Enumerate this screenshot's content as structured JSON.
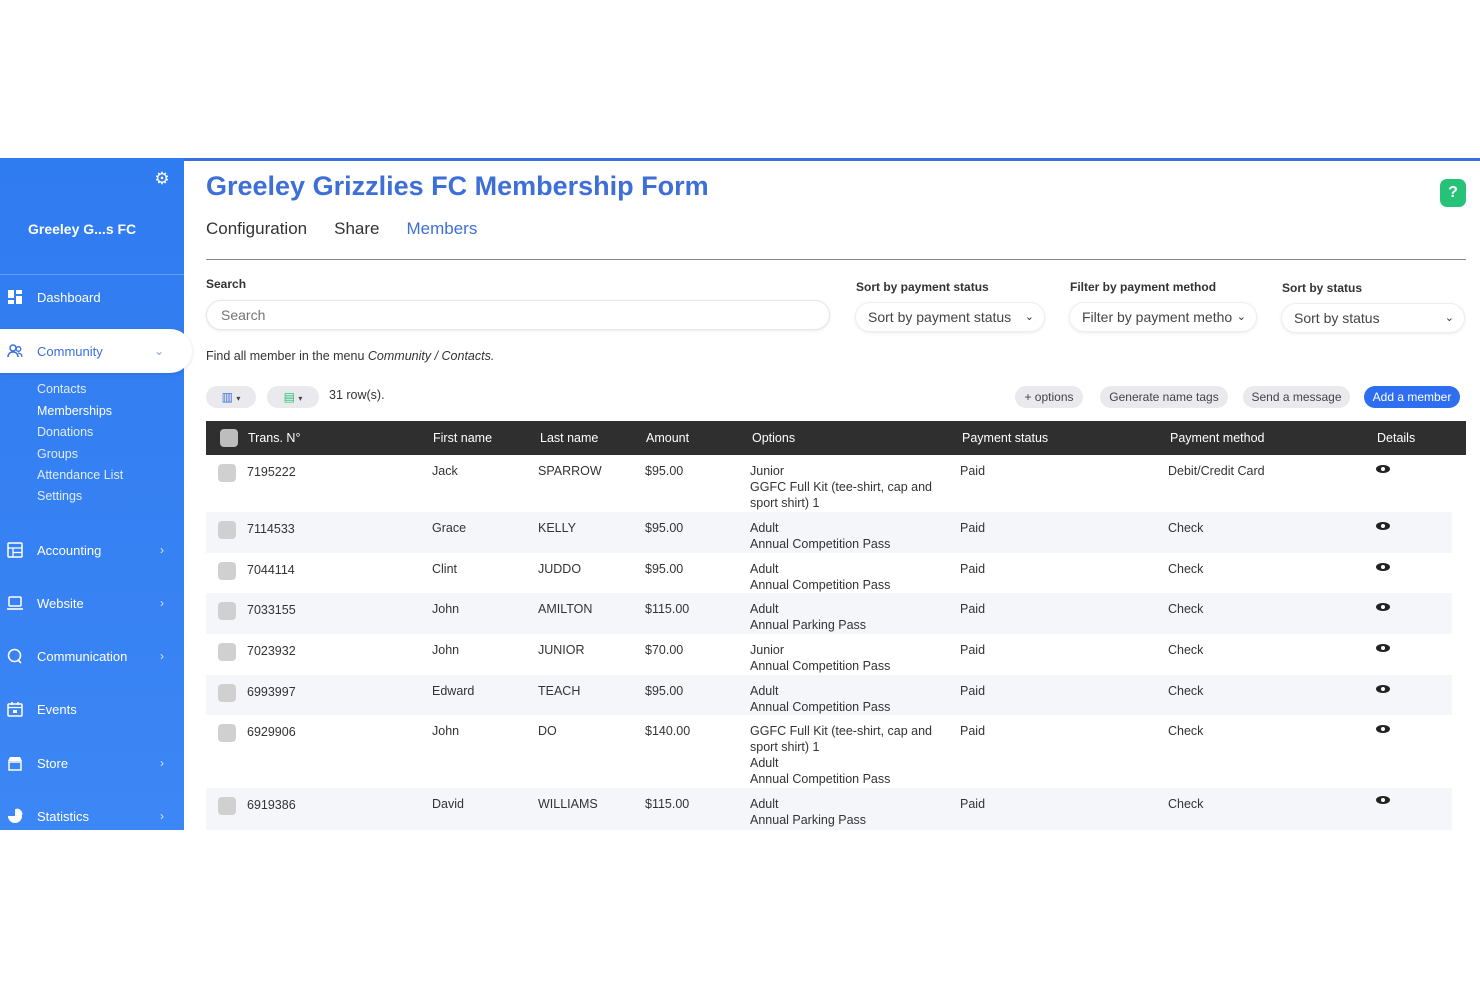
{
  "sidebar": {
    "org_name": "Greeley G...s FC",
    "nav": [
      {
        "label": "Dashboard",
        "icon": "dashboard-icon"
      },
      {
        "label": "Community",
        "icon": "community-icon"
      },
      {
        "label": "Accounting",
        "icon": "accounting-icon"
      },
      {
        "label": "Website",
        "icon": "website-icon"
      },
      {
        "label": "Communication",
        "icon": "communication-icon"
      },
      {
        "label": "Events",
        "icon": "events-icon"
      },
      {
        "label": "Store",
        "icon": "store-icon"
      },
      {
        "label": "Statistics",
        "icon": "statistics-icon"
      }
    ],
    "community_sub": [
      "Contacts",
      "Memberships",
      "Donations",
      "Groups",
      "Attendance List",
      "Settings"
    ]
  },
  "header": {
    "title": "Greeley Grizzlies FC Membership Form",
    "tabs": [
      "Configuration",
      "Share",
      "Members"
    ],
    "active_tab": "Members"
  },
  "filters": {
    "search_label": "Search",
    "search_placeholder": "Search",
    "sort_payment_label": "Sort by payment status",
    "sort_payment_value": "Sort by payment status",
    "filter_method_label": "Filter by payment method",
    "filter_method_value": "Filter by payment metho",
    "sort_status_label": "Sort by status",
    "sort_status_value": "Sort by status"
  },
  "hint": {
    "prefix": "Find all member in the menu ",
    "path": "Community / Contacts."
  },
  "toolbar": {
    "rows_count": "31 row(s).",
    "options": "+ options",
    "name_tags": "Generate name tags",
    "send_message": "Send a message",
    "add_member": "Add a member"
  },
  "table": {
    "headers": [
      "Trans. N°",
      "First name",
      "Last name",
      "Amount",
      "Options",
      "Payment status",
      "Payment method",
      "Details"
    ],
    "rows": [
      {
        "trans": "7195222",
        "first": "Jack",
        "last": "SPARROW",
        "amount": "$95.00",
        "options": [
          "Junior",
          "GGFC Full Kit (tee-shirt, cap and",
          "sport shirt) 1"
        ],
        "status": "Paid",
        "method": "Debit/Credit Card"
      },
      {
        "trans": "7114533",
        "first": "Grace",
        "last": "KELLY",
        "amount": "$95.00",
        "options": [
          "Adult",
          "Annual Competition Pass"
        ],
        "status": "Paid",
        "method": "Check"
      },
      {
        "trans": "7044114",
        "first": "Clint",
        "last": "JUDDO",
        "amount": "$95.00",
        "options": [
          "Adult",
          "Annual Competition Pass"
        ],
        "status": "Paid",
        "method": "Check"
      },
      {
        "trans": "7033155",
        "first": "John",
        "last": "AMILTON",
        "amount": "$115.00",
        "options": [
          "Adult",
          "Annual Parking Pass"
        ],
        "status": "Paid",
        "method": "Check"
      },
      {
        "trans": "7023932",
        "first": "John",
        "last": "JUNIOR",
        "amount": "$70.00",
        "options": [
          "Junior",
          "Annual Competition Pass"
        ],
        "status": "Paid",
        "method": "Check"
      },
      {
        "trans": "6993997",
        "first": "Edward",
        "last": "TEACH",
        "amount": "$95.00",
        "options": [
          "Adult",
          "Annual Competition Pass"
        ],
        "status": "Paid",
        "method": "Check"
      },
      {
        "trans": "6929906",
        "first": "John",
        "last": "DO",
        "amount": "$140.00",
        "options": [
          "GGFC Full Kit (tee-shirt, cap and",
          "sport shirt) 1",
          "Adult",
          "Annual Competition Pass"
        ],
        "status": "Paid",
        "method": "Check"
      },
      {
        "trans": "6919386",
        "first": "David",
        "last": "WILLIAMS",
        "amount": "$115.00",
        "options": [
          "Adult",
          "Annual Parking Pass"
        ],
        "status": "Paid",
        "method": "Check"
      }
    ]
  },
  "colors": {
    "sidebar": "#3b82f6",
    "accent": "#3d6fd6",
    "help": "#25c277",
    "primary_button": "#2f6ef0",
    "table_header": "#2f2f2f"
  }
}
